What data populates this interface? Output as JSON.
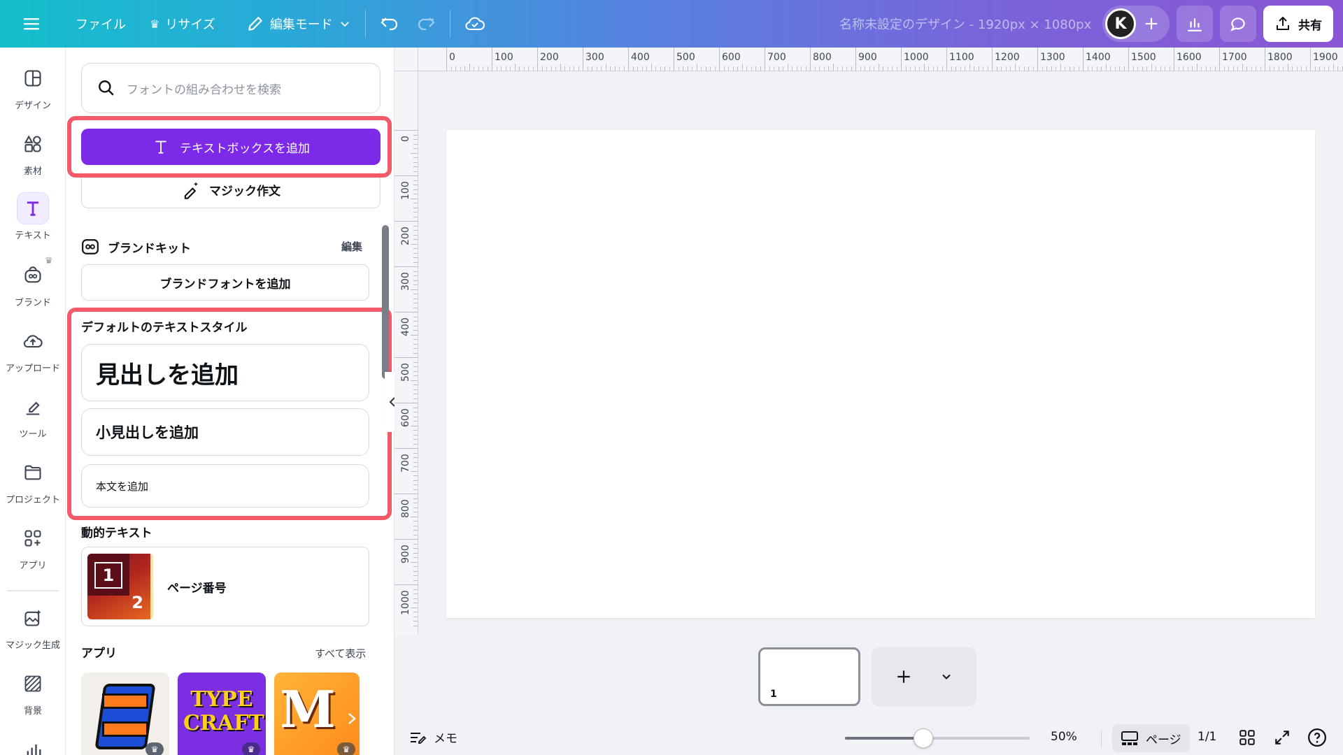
{
  "topbar": {
    "file": "ファイル",
    "resize": "リサイズ",
    "edit_mode": "編集モード",
    "title": "名称未設定のデザイン - 1920px × 1080px",
    "avatar": "K",
    "share": "共有"
  },
  "rail": {
    "items": [
      {
        "label": "デザイン",
        "icon": "layout-icon"
      },
      {
        "label": "素材",
        "icon": "shapes-icon"
      },
      {
        "label": "テキスト",
        "icon": "text-icon"
      },
      {
        "label": "ブランド",
        "icon": "brand-icon"
      },
      {
        "label": "アップロード",
        "icon": "cloud-upload-icon"
      },
      {
        "label": "ツール",
        "icon": "pen-icon"
      },
      {
        "label": "プロジェクト",
        "icon": "folder-icon"
      },
      {
        "label": "アプリ",
        "icon": "apps-icon"
      },
      {
        "label": "マジック生成",
        "icon": "magic-image-icon"
      },
      {
        "label": "背景",
        "icon": "pattern-icon"
      }
    ]
  },
  "panel": {
    "search_placeholder": "フォントの組み合わせを検索",
    "add_textbox": "テキストボックスを追加",
    "magic_write": "マジック作文",
    "brand_kit": {
      "title": "ブランドキット",
      "edit": "編集",
      "add_font": "ブランドフォントを追加"
    },
    "default_styles": {
      "title": "デフォルトのテキストスタイル",
      "heading": "見出しを追加",
      "subheading": "小見出しを追加",
      "body": "本文を追加"
    },
    "dynamic_text": {
      "title": "動的テキスト",
      "page_number": "ページ番号",
      "thumb_num1": "1",
      "thumb_num2": "2"
    },
    "apps": {
      "title": "アプリ",
      "see_all": "すべて表示",
      "typecraft": "TYPE CRAFT",
      "m_letter": "M"
    }
  },
  "canvas": {
    "hruler": [
      "0",
      "100",
      "200",
      "300",
      "400",
      "500",
      "600",
      "700",
      "800",
      "900",
      "1000",
      "1100",
      "1200",
      "1300",
      "1400",
      "1500",
      "1600",
      "1700",
      "1800",
      "1900"
    ],
    "vruler": [
      "0",
      "100",
      "200",
      "300",
      "400",
      "500",
      "600",
      "700",
      "800",
      "900",
      "1000"
    ],
    "page_number": "1"
  },
  "bottombar": {
    "notes": "メモ",
    "zoom": "50%",
    "zoom_level": 50,
    "pages_btn": "ページ",
    "page_count": "1/1"
  },
  "colors": {
    "accent": "#7d2ae8",
    "highlight": "#f25a6a"
  }
}
